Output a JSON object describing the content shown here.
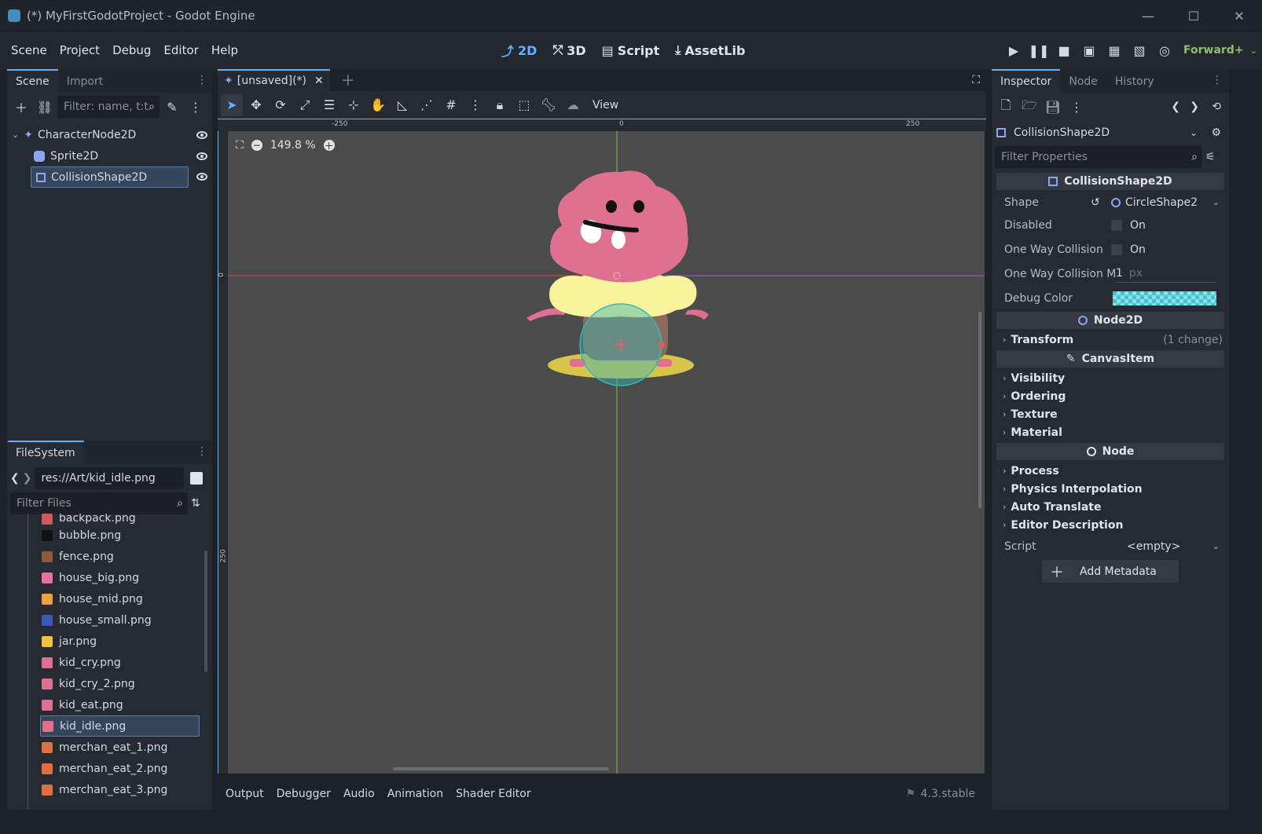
{
  "window": {
    "title": "(*) MyFirstGodotProject - Godot Engine",
    "minimize": "—",
    "maximize": "☐",
    "close": "✕"
  },
  "menu": [
    "Scene",
    "Project",
    "Debug",
    "Editor",
    "Help"
  ],
  "workspaces": [
    {
      "label": "2D",
      "icon": "2d-icon",
      "active": true
    },
    {
      "label": "3D",
      "icon": "3d-icon",
      "active": false
    },
    {
      "label": "Script",
      "icon": "script-icon",
      "active": false
    },
    {
      "label": "AssetLib",
      "icon": "assetlib-icon",
      "active": false
    }
  ],
  "renderer": "Forward+",
  "scene_dock": {
    "tabs": [
      "Scene",
      "Import"
    ],
    "filter_placeholder": "Filter: name, t:t",
    "tree": [
      {
        "label": "CharacterNode2D",
        "icon": "character-body-icon",
        "level": 0
      },
      {
        "label": "Sprite2D",
        "icon": "sprite-icon",
        "level": 1
      },
      {
        "label": "CollisionShape2D",
        "icon": "collision-shape-icon",
        "level": 1,
        "selected": true
      }
    ]
  },
  "filesystem": {
    "tab": "FileSystem",
    "path": "res://Art/kid_idle.png",
    "filter_placeholder": "Filter Files",
    "files": [
      {
        "name": "backpack.png",
        "color": "#d05a5a"
      },
      {
        "name": "bubble.png",
        "color": "#111111"
      },
      {
        "name": "fence.png",
        "color": "#8a5a3a"
      },
      {
        "name": "house_big.png",
        "color": "#e8739a"
      },
      {
        "name": "house_mid.png",
        "color": "#f0a040"
      },
      {
        "name": "house_small.png",
        "color": "#3a5ab8"
      },
      {
        "name": "jar.png",
        "color": "#f0c040"
      },
      {
        "name": "kid_cry.png",
        "color": "#e07090"
      },
      {
        "name": "kid_cry_2.png",
        "color": "#e07090"
      },
      {
        "name": "kid_eat.png",
        "color": "#e07090"
      },
      {
        "name": "kid_idle.png",
        "color": "#e07090",
        "selected": true
      },
      {
        "name": "merchan_eat_1.png",
        "color": "#e07040"
      },
      {
        "name": "merchan_eat_2.png",
        "color": "#e07040"
      },
      {
        "name": "merchan_eat_3.png",
        "color": "#e07040"
      }
    ]
  },
  "editor": {
    "tab_label": "[unsaved](*)",
    "view_label": "View",
    "zoom": "149.8 %",
    "ruler": [
      "-250",
      "0",
      "250"
    ],
    "vruler": [
      "0",
      "250"
    ]
  },
  "bottom_panel": {
    "tabs": [
      "Output",
      "Debugger",
      "Audio",
      "Animation",
      "Shader Editor"
    ],
    "version": "4.3.stable"
  },
  "inspector": {
    "tabs": [
      "Inspector",
      "Node",
      "History"
    ],
    "object": "CollisionShape2D",
    "filter_placeholder": "Filter Properties",
    "section_collision": "CollisionShape2D",
    "props": {
      "shape_label": "Shape",
      "shape_value": "CircleShape2",
      "disabled_label": "Disabled",
      "disabled_value": "On",
      "oneway_label": "One Way Collision",
      "oneway_value": "On",
      "margin_label": "One Way Collision M",
      "margin_value": "1",
      "margin_unit": "px",
      "debug_label": "Debug Color"
    },
    "section_node2d": "Node2D",
    "transform_label": "Transform",
    "transform_change": "(1 change)",
    "section_canvas": "CanvasItem",
    "canvas_groups": [
      "Visibility",
      "Ordering",
      "Texture",
      "Material"
    ],
    "section_node": "Node",
    "node_groups": [
      "Process",
      "Physics Interpolation",
      "Auto Translate",
      "Editor Description"
    ],
    "script_label": "Script",
    "script_value": "<empty>",
    "add_metadata": "Add Metadata"
  }
}
